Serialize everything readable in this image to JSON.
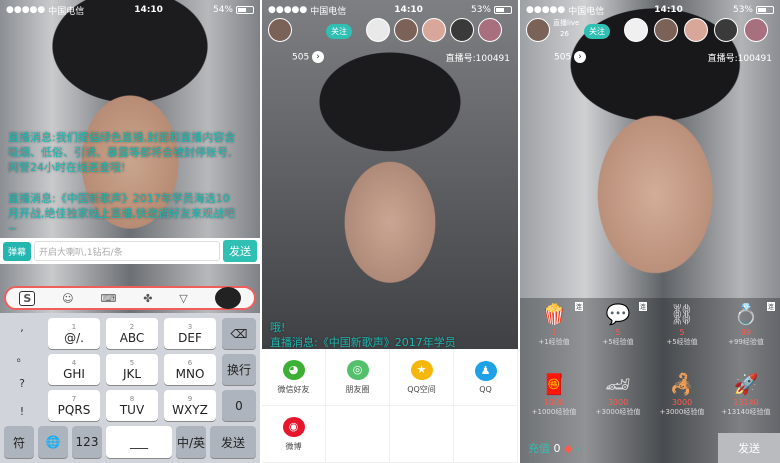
{
  "status": {
    "carrier": "中国电信",
    "time": "14:10",
    "battery_left": "54%",
    "battery_mid": "53%",
    "battery_right": "53%"
  },
  "phone1": {
    "message1": "直播消息:我们提倡绿色直播,封面和直播内容含吸烟、低俗、引诱、暴露等都将会被封停账号,网警24小时在线巡查哦!",
    "message2": "直播消息:《中国新歌声》2017年学员海选10月开战,绝佳独家线上直播,快邀请好友来观战吧~",
    "danmu_label": "弹幕",
    "input_placeholder": "开启大喇叭,1钻石/条",
    "send_label": "发送",
    "keys": {
      "row1": [
        {
          "main": "@/.",
          "sub": "1"
        },
        {
          "main": "ABC",
          "sub": "2"
        },
        {
          "main": "DEF",
          "sub": "3"
        }
      ],
      "row2": [
        {
          "main": "GHI",
          "sub": "4"
        },
        {
          "main": "JKL",
          "sub": "5"
        },
        {
          "main": "MNO",
          "sub": "6"
        }
      ],
      "row3": [
        {
          "main": "PQRS",
          "sub": "7"
        },
        {
          "main": "TUV",
          "sub": "8"
        },
        {
          "main": "WXYZ",
          "sub": "9"
        }
      ],
      "side": [
        ",",
        "。",
        "?",
        "!"
      ],
      "newline": "换行",
      "zero": "0",
      "symbol": "符",
      "num": "123",
      "space": "___",
      "lang": "中/英",
      "send": "发送",
      "delete": "⌫"
    }
  },
  "phone2": {
    "follow": "关注",
    "count": "505",
    "room_id": "直播号:100491",
    "chat1": "哦!",
    "chat2": "直播消息:《中国新歌声》2017年学员",
    "share": [
      {
        "label": "微信好友",
        "icon": "wechat-icon",
        "color": "#3cb034"
      },
      {
        "label": "朋友圈",
        "icon": "moments-icon",
        "color": "#53c16b"
      },
      {
        "label": "QQ空间",
        "icon": "qzone-icon",
        "color": "#f6b70d"
      },
      {
        "label": "QQ",
        "icon": "qq-icon",
        "color": "#1ea1e6"
      },
      {
        "label": "微博",
        "icon": "weibo-icon",
        "color": "#e6162d"
      }
    ]
  },
  "phone3": {
    "host_name": "直播live",
    "host_sub": "26",
    "follow": "关注",
    "count": "505",
    "room_id": "直播号:100491",
    "recharge": "充值",
    "balance": "0",
    "send": "发送",
    "gifts": [
      {
        "name": "popcorn",
        "price": "1",
        "exp": "+1经验值",
        "glyph": "🍿",
        "tag": "连"
      },
      {
        "name": "soap",
        "price": "5",
        "exp": "+5经验值",
        "glyph": "💬",
        "tag": "连"
      },
      {
        "name": "handcuffs",
        "price": "5",
        "exp": "+5经验值",
        "glyph": "⛓",
        "tag": ""
      },
      {
        "name": "ring",
        "price": "99",
        "exp": "+99经验值",
        "glyph": "💍",
        "tag": "连"
      },
      {
        "name": "red-envelope",
        "price": "1000",
        "exp": "+1000经验值",
        "glyph": "🧧",
        "tag": ""
      },
      {
        "name": "sports-car",
        "price": "3000",
        "exp": "+3000经验值",
        "glyph": "🏎",
        "tag": ""
      },
      {
        "name": "scorpion",
        "price": "3000",
        "exp": "+3000经验值",
        "glyph": "🦂",
        "tag": ""
      },
      {
        "name": "rocket",
        "price": "13140",
        "exp": "+13140经验值",
        "glyph": "🚀",
        "tag": ""
      }
    ]
  }
}
